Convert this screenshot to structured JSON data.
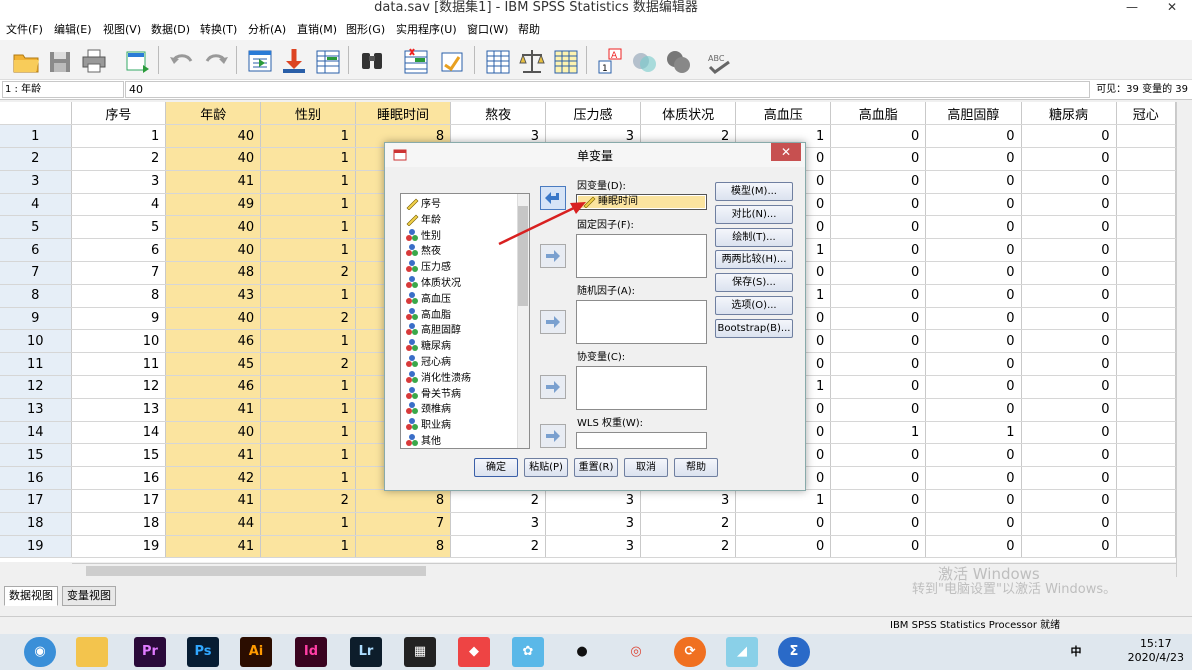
{
  "window": {
    "title": "data.sav [数据集1] - IBM SPSS Statistics 数据编辑器",
    "minimize": "—",
    "close": "✕"
  },
  "menu": [
    "文件(F)",
    "编辑(E)",
    "视图(V)",
    "数据(D)",
    "转换(T)",
    "分析(A)",
    "直销(M)",
    "图形(G)",
    "实用程序(U)",
    "窗口(W)",
    "帮助"
  ],
  "cellbar": {
    "ref": "1 : 年龄",
    "value": "40",
    "visible": "可见：39 变量的 39"
  },
  "grid": {
    "columns": [
      "序号",
      "年龄",
      "性别",
      "睡眠时间",
      "熬夜",
      "压力感",
      "体质状况",
      "高血压",
      "高血脂",
      "高胆固醇",
      "糖尿病",
      "冠心"
    ],
    "rows": [
      [
        "1",
        "1",
        "40",
        "1",
        "8",
        "3",
        "3",
        "2",
        "1",
        "0",
        "0",
        "0",
        ""
      ],
      [
        "2",
        "2",
        "40",
        "1",
        "",
        "",
        "",
        "",
        "0",
        "0",
        "0",
        "0",
        ""
      ],
      [
        "3",
        "3",
        "41",
        "1",
        "",
        "",
        "",
        "",
        "0",
        "0",
        "0",
        "0",
        ""
      ],
      [
        "4",
        "4",
        "49",
        "1",
        "",
        "",
        "",
        "",
        "0",
        "0",
        "0",
        "0",
        ""
      ],
      [
        "5",
        "5",
        "40",
        "1",
        "",
        "",
        "",
        "",
        "0",
        "0",
        "0",
        "0",
        ""
      ],
      [
        "6",
        "6",
        "40",
        "1",
        "",
        "",
        "",
        "",
        "1",
        "0",
        "0",
        "0",
        ""
      ],
      [
        "7",
        "7",
        "48",
        "2",
        "",
        "",
        "",
        "",
        "0",
        "0",
        "0",
        "0",
        ""
      ],
      [
        "8",
        "8",
        "43",
        "1",
        "",
        "",
        "",
        "",
        "1",
        "0",
        "0",
        "0",
        ""
      ],
      [
        "9",
        "9",
        "40",
        "2",
        "",
        "",
        "",
        "",
        "0",
        "0",
        "0",
        "0",
        ""
      ],
      [
        "10",
        "10",
        "46",
        "1",
        "",
        "",
        "",
        "",
        "0",
        "0",
        "0",
        "0",
        ""
      ],
      [
        "11",
        "11",
        "45",
        "2",
        "",
        "",
        "",
        "",
        "0",
        "0",
        "0",
        "0",
        ""
      ],
      [
        "12",
        "12",
        "46",
        "1",
        "",
        "",
        "",
        "",
        "1",
        "0",
        "0",
        "0",
        ""
      ],
      [
        "13",
        "13",
        "41",
        "1",
        "",
        "",
        "",
        "",
        "0",
        "0",
        "0",
        "0",
        ""
      ],
      [
        "14",
        "14",
        "40",
        "1",
        "",
        "",
        "",
        "",
        "0",
        "1",
        "1",
        "0",
        ""
      ],
      [
        "15",
        "15",
        "41",
        "1",
        "",
        "",
        "",
        "",
        "0",
        "0",
        "0",
        "0",
        ""
      ],
      [
        "16",
        "16",
        "42",
        "1",
        "",
        "",
        "",
        "",
        "0",
        "0",
        "0",
        "0",
        ""
      ],
      [
        "17",
        "17",
        "41",
        "2",
        "8",
        "2",
        "3",
        "3",
        "1",
        "0",
        "0",
        "0",
        ""
      ],
      [
        "18",
        "18",
        "44",
        "1",
        "7",
        "3",
        "3",
        "2",
        "0",
        "0",
        "0",
        "0",
        ""
      ],
      [
        "19",
        "19",
        "41",
        "1",
        "8",
        "2",
        "3",
        "2",
        "0",
        "0",
        "0",
        "0",
        ""
      ]
    ]
  },
  "tabs": {
    "data": "数据视图",
    "variable": "变量视图"
  },
  "status": "IBM SPSS Statistics Processor 就绪",
  "watermark": {
    "line1": "激活 Windows",
    "line2": "转到\"电脑设置\"以激活 Windows。"
  },
  "dialog": {
    "title": "单变量",
    "variables": [
      "序号",
      "年龄",
      "性别",
      "熬夜",
      "压力感",
      "体质状况",
      "高血压",
      "高血脂",
      "高胆固醇",
      "糖尿病",
      "冠心病",
      "消化性溃疡",
      "骨关节病",
      "颈椎病",
      "职业病",
      "其他"
    ],
    "dependent_label": "因变量(D):",
    "dependent_value": "睡眠时间",
    "fixed_label": "固定因子(F):",
    "random_label": "随机因子(A):",
    "covariate_label": "协变量(C):",
    "wls_label": "WLS 权重(W):",
    "side_buttons": [
      "模型(M)...",
      "对比(N)...",
      "绘制(T)...",
      "两两比较(H)...",
      "保存(S)...",
      "选项(O)...",
      "Bootstrap(B)..."
    ],
    "bottom_buttons": [
      "确定",
      "粘贴(P)",
      "重置(R)",
      "取消",
      "帮助"
    ]
  },
  "taskbar": {
    "time": "15:17",
    "date": "2020/4/23",
    "ime": "中"
  }
}
